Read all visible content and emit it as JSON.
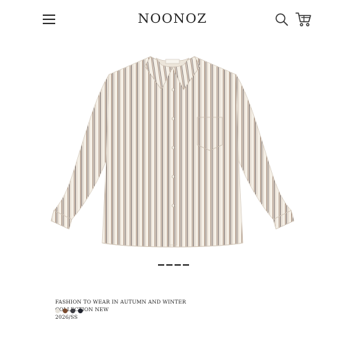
{
  "header": {
    "brand": "NOONOZ",
    "menu_icon": "hamburger-menu-icon",
    "search_icon": "search-icon",
    "cart_icon": "shopping-cart-icon"
  },
  "product": {
    "image_alt_icon": "striped-shirt-image",
    "description_line1": "FASHION TO WEAR IN AUTUMN AND WINTER",
    "description_line2": "COLLECTION NEW",
    "season": "2026/SS",
    "swatches": [
      {
        "color": "#e6e2da"
      },
      {
        "color": "#7a4a2e"
      },
      {
        "color": "#3c3c42"
      },
      {
        "color": "#20232e"
      }
    ]
  },
  "carousel": {
    "total": 4,
    "active_index": 0
  }
}
